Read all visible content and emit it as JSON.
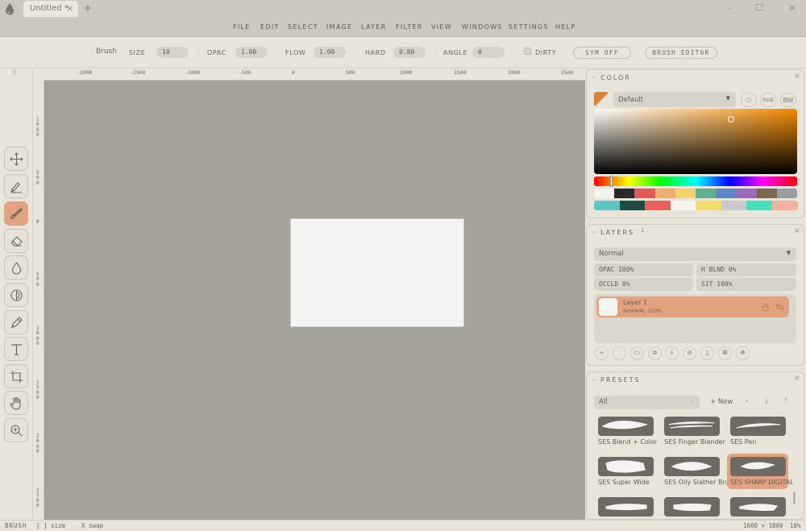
{
  "window": {
    "tab_title": "Untitled *",
    "tab_close": "×",
    "new_tab": "+",
    "minimize": "–",
    "maximize": "☐",
    "close": "×"
  },
  "menu": [
    "FILE",
    "EDIT",
    "SELECT",
    "IMAGE",
    "LAYER",
    "FILTER",
    "VIEW",
    "WINDOWS",
    "SETTINGS",
    "HELP"
  ],
  "options": {
    "tool_name": "Brush",
    "size_label": "SIZE",
    "size_value": "10",
    "opac_label": "OPAC",
    "opac_value": "1.00",
    "flow_label": "FLOW",
    "flow_value": "1.00",
    "hard_label": "HARD",
    "hard_value": "0.80",
    "angle_label": "ANGLE",
    "angle_value": "0",
    "dirty_label": "DIRTY",
    "sym_button": "SYM OFF",
    "brush_editor_button": "BRUSH EDITOR"
  },
  "rulers": {
    "top": [
      "-2000",
      "-1500",
      "-1000",
      "-500",
      "0",
      "500",
      "1000",
      "1500",
      "2000",
      "2500"
    ],
    "left": [
      "1000",
      "500",
      "0",
      "500",
      "1000",
      "1500",
      "2000",
      "2500"
    ]
  },
  "tools": [
    {
      "name": "move-tool",
      "active": false
    },
    {
      "name": "smudge-tool",
      "active": false
    },
    {
      "name": "brush-tool",
      "active": true
    },
    {
      "name": "eraser-tool",
      "active": false
    },
    {
      "name": "fill-tool",
      "active": false
    },
    {
      "name": "dodge-tool",
      "active": false
    },
    {
      "name": "pen-tool",
      "active": false
    },
    {
      "name": "text-tool",
      "active": false
    },
    {
      "name": "crop-tool",
      "active": false
    },
    {
      "name": "hand-tool",
      "active": false
    },
    {
      "name": "zoom-tool",
      "active": false
    }
  ],
  "color_panel": {
    "title": "COLOR",
    "palette_select": "Default",
    "rgb_label": "RGB",
    "bw_label": "BW",
    "current_color": "#d8833a",
    "swatches_row1": [
      "#f4f3ef",
      "#2a2a2a",
      "#e05a55",
      "#efb06a",
      "#f0d36a",
      "#5cb38d",
      "#5f86c9",
      "#9a6bbf",
      "#7d6650",
      "#9c9ca4"
    ],
    "swatches_row2": [
      "#5cc6c2",
      "#1f4a46",
      "#e86058",
      "#f6f4ef",
      "#f3dc6b",
      "#c9c9cf",
      "#44e0bc",
      "#f3b29f"
    ]
  },
  "layers_panel": {
    "title": "LAYERS",
    "count": "1",
    "blend_mode": "Normal",
    "opac": "OPAC 100%",
    "hblnd": "H BLND 0%",
    "occld": "OCCLD 0%",
    "sit": "SIT 100%",
    "layers": [
      {
        "name": "Layer 1",
        "detail": "NORMAL  100%"
      }
    ]
  },
  "presets_panel": {
    "title": "PRESETS",
    "filter": "All",
    "new_button": "+ New",
    "items": [
      {
        "name": "SES Blend + Color",
        "active": false
      },
      {
        "name": "SES Finger Blender",
        "active": false
      },
      {
        "name": "SES Pen",
        "active": false
      },
      {
        "name": "SES Super Wide",
        "active": false
      },
      {
        "name": "SES Oily Slather Brush",
        "active": false
      },
      {
        "name": "SES SHARP DIGITAL",
        "active": true
      },
      {
        "name": "",
        "active": false
      },
      {
        "name": "",
        "active": false
      },
      {
        "name": "",
        "active": false
      }
    ]
  },
  "status": {
    "mode": "BRUSH",
    "hint1": "[ ] size",
    "hint2": "X swap",
    "doc_size": "1600 × 1000",
    "zoom": "18%"
  }
}
